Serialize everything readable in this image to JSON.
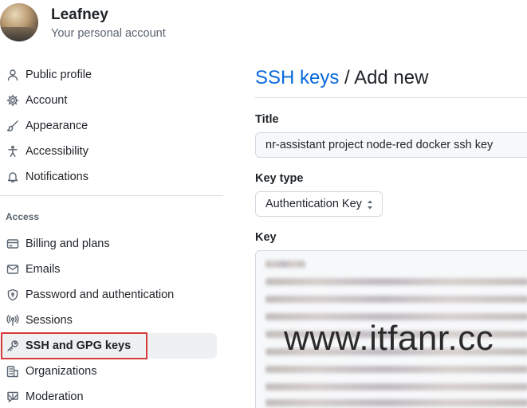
{
  "account": {
    "name": "Leafney",
    "subtitle": "Your personal account"
  },
  "sidebar": {
    "items_top": [
      {
        "label": "Public profile",
        "icon": "person-icon"
      },
      {
        "label": "Account",
        "icon": "gear-icon"
      },
      {
        "label": "Appearance",
        "icon": "paintbrush-icon"
      },
      {
        "label": "Accessibility",
        "icon": "accessibility-icon"
      },
      {
        "label": "Notifications",
        "icon": "bell-icon"
      }
    ],
    "section_access": "Access",
    "items_access": [
      {
        "label": "Billing and plans",
        "icon": "credit-card-icon"
      },
      {
        "label": "Emails",
        "icon": "mail-icon"
      },
      {
        "label": "Password and authentication",
        "icon": "shield-lock-icon"
      },
      {
        "label": "Sessions",
        "icon": "broadcast-icon"
      },
      {
        "label": "SSH and GPG keys",
        "icon": "key-icon",
        "active": true
      },
      {
        "label": "Organizations",
        "icon": "organization-icon"
      },
      {
        "label": "Moderation",
        "icon": "report-icon",
        "expandable": true
      }
    ]
  },
  "main": {
    "breadcrumb_link": "SSH keys",
    "breadcrumb_separator": " / ",
    "page_title": "Add new",
    "title_field": {
      "label": "Title",
      "value": "nr-assistant project node-red docker ssh key"
    },
    "key_type_field": {
      "label": "Key type",
      "selected": "Authentication Key"
    },
    "key_field": {
      "label": "Key"
    }
  },
  "watermark": "www.itfanr.cc",
  "colors": {
    "link": "#0969da",
    "highlight_border": "#d93a3a",
    "active_bg": "#eef0f2"
  }
}
